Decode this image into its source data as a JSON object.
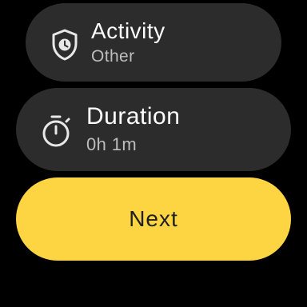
{
  "theme": {
    "background": "#000000",
    "chip_background": "#2c2c2c",
    "primary_button": "#fdd542",
    "primary_button_text": "#202020",
    "secondary_text": "#bdbdbd"
  },
  "activity": {
    "title": "Activity",
    "value": "Other",
    "icon": "shield-clock-icon"
  },
  "duration": {
    "title": "Duration",
    "value": "0h 1m",
    "icon": "stopwatch-icon"
  },
  "next_button": {
    "label": "Next"
  }
}
